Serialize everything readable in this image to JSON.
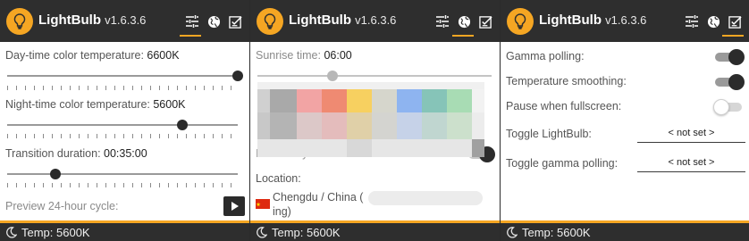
{
  "app": {
    "name": "LightBulb",
    "version": "v1.6.3.6"
  },
  "colors": {
    "accent": "#f5a623",
    "header": "#2e2e2e",
    "text": "#3a3a3a",
    "flag_red": "#de2910"
  },
  "icons": {
    "logo": "lightbulb-icon",
    "tab1": "sliders-icon",
    "tab2": "globe-icon",
    "tab3": "checklist-icon",
    "footer": "moon-icon",
    "play": "play-icon"
  },
  "panels": {
    "general": {
      "active_tab": 1,
      "day_temp_label": "Day-time color temperature:",
      "day_temp_value": "6600K",
      "day_temp_level": 1.0,
      "night_temp_label": "Night-time color temperature:",
      "night_temp_value": "5600K",
      "night_temp_level": 0.76,
      "transition_label": "Transition duration:",
      "transition_value": "00:35:00",
      "transition_level": 0.21,
      "preview_label": "Preview 24-hour cycle:",
      "footer_temp": "Temp: 5600K"
    },
    "location": {
      "active_tab": 2,
      "sunrise_label": "Sunrise time:",
      "sunrise_value": "06:00",
      "sunrise_level": 0.32,
      "internet_sync_label": "Internet synchronization:",
      "location_label": "Location:",
      "location_value": "Chengdu / China (",
      "location_tail": "ing)",
      "footer_temp": "Temp: 5600K"
    },
    "advanced": {
      "active_tab": 3,
      "gamma_polling_label": "Gamma polling:",
      "gamma_polling_on": true,
      "temp_smoothing_label": "Temperature smoothing:",
      "temp_smoothing_on": true,
      "pause_fullscreen_label": "Pause when fullscreen:",
      "pause_fullscreen_on": false,
      "toggle_lightbulb_label": "Toggle LightBulb:",
      "toggle_lightbulb_value": "< not set >",
      "toggle_gamma_label": "Toggle gamma polling:",
      "toggle_gamma_value": "< not set >",
      "footer_temp": "Temp: 5600K"
    }
  }
}
